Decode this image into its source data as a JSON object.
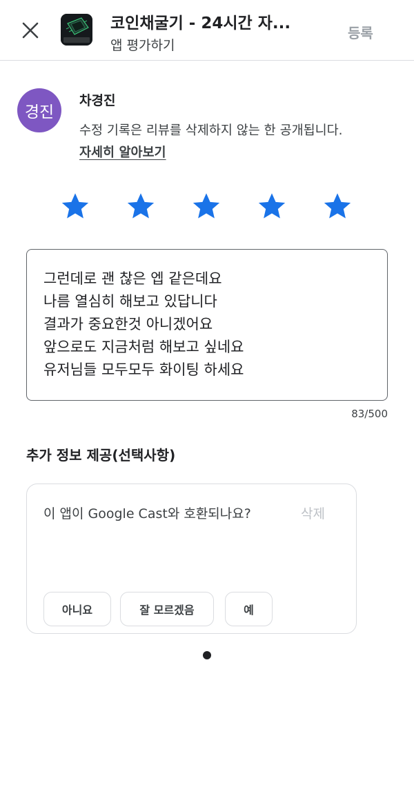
{
  "header": {
    "app_title": "코인채굴기 - 24시간 자...",
    "subtitle": "앱 평가하기",
    "submit_label": "등록",
    "icon_text": "코인채굴기"
  },
  "user": {
    "avatar_text": "경진",
    "name": "차경진",
    "notice": "수정 기록은 리뷰를 삭제하지 않는 한 공개됩니다.",
    "learn_more": "자세히 알아보기"
  },
  "rating": {
    "value": 5,
    "max": 5,
    "color": "#1a73e8"
  },
  "review": {
    "text": "그런데로 괜 찮은 엡 같은데요\n나름 열심히 해보고 있답니다\n결과가 중요한것 아니겠어요\n앞으로도 지금처럼 해보고 싶네요\n유저님들 모두모두 화이팅 하세요",
    "char_count": "83/500"
  },
  "extra_info": {
    "heading": "추가 정보 제공(선택사항)",
    "question": "이 앱이 Google Cast와 호환되나요?",
    "delete_label": "삭제",
    "options": [
      "아니요",
      "잘 모르겠음",
      "예"
    ]
  },
  "colors": {
    "avatar": "#7e57c2",
    "star": "#1a73e8"
  }
}
